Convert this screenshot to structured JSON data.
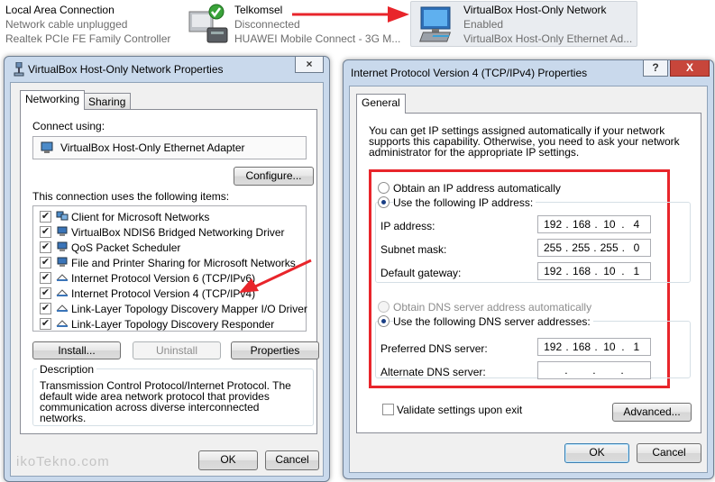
{
  "connections": [
    {
      "name": "Local Area Connection",
      "status": "Network cable unplugged",
      "device": "Realtek PCIe FE Family Controller"
    },
    {
      "name": "Telkomsel",
      "status": "Disconnected",
      "device": "HUAWEI Mobile Connect - 3G M..."
    },
    {
      "name": "VirtualBox Host-Only Network",
      "status": "Enabled",
      "device": "VirtualBox Host-Only Ethernet Ad..."
    }
  ],
  "props_window": {
    "title": "VirtualBox Host-Only Network Properties",
    "tabs": [
      "Networking",
      "Sharing"
    ],
    "connect_using_label": "Connect using:",
    "adapter": "VirtualBox Host-Only Ethernet Adapter",
    "configure_label": "Configure...",
    "items_label": "This connection uses the following items:",
    "items": [
      {
        "label": "Client for Microsoft Networks",
        "checked": true
      },
      {
        "label": "VirtualBox NDIS6 Bridged Networking Driver",
        "checked": true
      },
      {
        "label": "QoS Packet Scheduler",
        "checked": true
      },
      {
        "label": "File and Printer Sharing for Microsoft Networks",
        "checked": true
      },
      {
        "label": "Internet Protocol Version 6 (TCP/IPv6)",
        "checked": true
      },
      {
        "label": "Internet Protocol Version 4 (TCP/IPv4)",
        "checked": true
      },
      {
        "label": "Link-Layer Topology Discovery Mapper I/O Driver",
        "checked": true
      },
      {
        "label": "Link-Layer Topology Discovery Responder",
        "checked": true
      }
    ],
    "install_label": "Install...",
    "uninstall_label": "Uninstall",
    "properties_label": "Properties",
    "description_label": "Description",
    "description_text": "Transmission Control Protocol/Internet Protocol. The default wide area network protocol that provides communication across diverse interconnected networks.",
    "ok_label": "OK",
    "cancel_label": "Cancel"
  },
  "ipv4_window": {
    "title": "Internet Protocol Version 4 (TCP/IPv4) Properties",
    "help_button": "?",
    "close_button": "X",
    "tab": "General",
    "intro": "You can get IP settings assigned automatically if your network supports this capability. Otherwise, you need to ask your network administrator for the appropriate IP settings.",
    "obtain_ip_auto": "Obtain an IP address automatically",
    "use_following_ip": "Use the following IP address:",
    "ip_address_label": "IP address:",
    "ip_address": [
      "192",
      "168",
      "10",
      "4"
    ],
    "subnet_label": "Subnet mask:",
    "subnet": [
      "255",
      "255",
      "255",
      "0"
    ],
    "gateway_label": "Default gateway:",
    "gateway": [
      "192",
      "168",
      "10",
      "1"
    ],
    "obtain_dns_auto": "Obtain DNS server address automatically",
    "use_following_dns": "Use the following DNS server addresses:",
    "preferred_dns_label": "Preferred DNS server:",
    "preferred_dns": [
      "192",
      "168",
      "10",
      "1"
    ],
    "alternate_dns_label": "Alternate DNS server:",
    "alternate_dns": [
      "",
      "",
      "",
      ""
    ],
    "validate_label": "Validate settings upon exit",
    "advanced_label": "Advanced...",
    "ok_label": "OK",
    "cancel_label": "Cancel"
  },
  "watermark": "ikoTekno.com",
  "colors": {
    "annotation_red": "#e8252b",
    "selection_bg": "#e9ecf0",
    "window_frame": "#c9d9ec"
  }
}
